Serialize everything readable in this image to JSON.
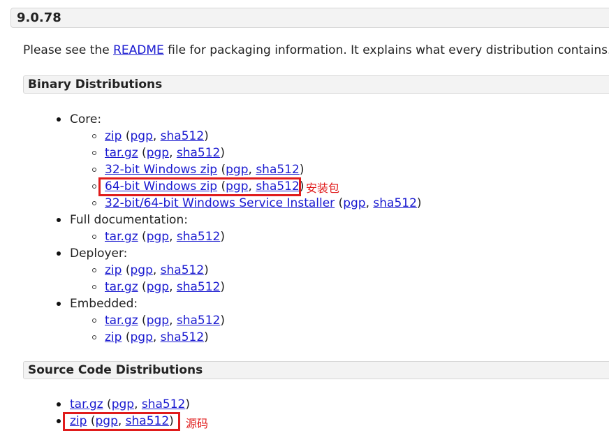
{
  "version": "9.0.78",
  "intro": {
    "before": "Please see the ",
    "link": "README",
    "after": " file for packaging information. It explains what every distribution contains."
  },
  "binary": {
    "title": "Binary Distributions",
    "core": {
      "label": "Core:",
      "items": [
        {
          "main": "zip",
          "pgp": "pgp",
          "sha": "sha512"
        },
        {
          "main": "tar.gz",
          "pgp": "pgp",
          "sha": "sha512"
        },
        {
          "main": "32-bit Windows zip",
          "pgp": "pgp",
          "sha": "sha512"
        },
        {
          "main": "64-bit Windows zip",
          "pgp": "pgp",
          "sha": "sha512"
        },
        {
          "main": "32-bit/64-bit Windows Service Installer",
          "pgp": "pgp",
          "sha": "sha512"
        }
      ]
    },
    "fulldoc": {
      "label": "Full documentation:",
      "items": [
        {
          "main": "tar.gz",
          "pgp": "pgp",
          "sha": "sha512"
        }
      ]
    },
    "deployer": {
      "label": "Deployer:",
      "items": [
        {
          "main": "zip",
          "pgp": "pgp",
          "sha": "sha512"
        },
        {
          "main": "tar.gz",
          "pgp": "pgp",
          "sha": "sha512"
        }
      ]
    },
    "embedded": {
      "label": "Embedded:",
      "items": [
        {
          "main": "tar.gz",
          "pgp": "pgp",
          "sha": "sha512"
        },
        {
          "main": "zip",
          "pgp": "pgp",
          "sha": "sha512"
        }
      ]
    }
  },
  "source": {
    "title": "Source Code Distributions",
    "items": [
      {
        "main": "tar.gz",
        "pgp": "pgp",
        "sha": "sha512"
      },
      {
        "main": "zip",
        "pgp": "pgp",
        "sha": "sha512"
      }
    ]
  },
  "punct": {
    "open": " (",
    "comma": ", ",
    "close": ")"
  },
  "annotations": {
    "installer": "安装包",
    "source": "源码",
    "color": "#e01b1b"
  }
}
